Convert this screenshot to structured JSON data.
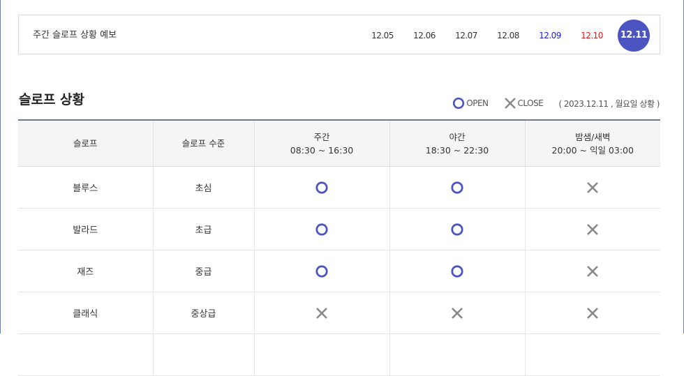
{
  "forecast": {
    "title": "주간 슬로프 상황 예보",
    "dates": [
      {
        "label": "12.05",
        "color": "#333333"
      },
      {
        "label": "12.06",
        "color": "#333333"
      },
      {
        "label": "12.07",
        "color": "#333333"
      },
      {
        "label": "12.08",
        "color": "#333333"
      },
      {
        "label": "12.09",
        "color": "#1a1ae0"
      },
      {
        "label": "12.10",
        "color": "#e01a1a"
      }
    ],
    "selected": "12.11",
    "accent": "#4a55c2"
  },
  "status": {
    "title": "슬로프 상황",
    "legend_open": "OPEN",
    "legend_close": "CLOSE",
    "date_note": "( 2023.12.11 , 월요일 상황 )",
    "open_color": "#4a55c2",
    "close_color": "#888888",
    "columns": [
      {
        "name": "슬로프",
        "time": ""
      },
      {
        "name": "슬로프 수준",
        "time": ""
      },
      {
        "name": "주간",
        "time": "08:30 ~ 16:30"
      },
      {
        "name": "야간",
        "time": "18:30 ~ 22:30"
      },
      {
        "name": "밤샘/새벽",
        "time": "20:00 ~ 익일 03:00"
      }
    ],
    "rows": [
      {
        "slope": "블루스",
        "level": "초심",
        "day": "open",
        "night": "open",
        "late": "close"
      },
      {
        "slope": "발라드",
        "level": "초급",
        "day": "open",
        "night": "open",
        "late": "close"
      },
      {
        "slope": "재즈",
        "level": "중급",
        "day": "open",
        "night": "open",
        "late": "close"
      },
      {
        "slope": "클래식",
        "level": "중상급",
        "day": "close",
        "night": "close",
        "late": "close"
      },
      {
        "slope": "",
        "level": "",
        "day": "",
        "night": "",
        "late": ""
      }
    ]
  }
}
